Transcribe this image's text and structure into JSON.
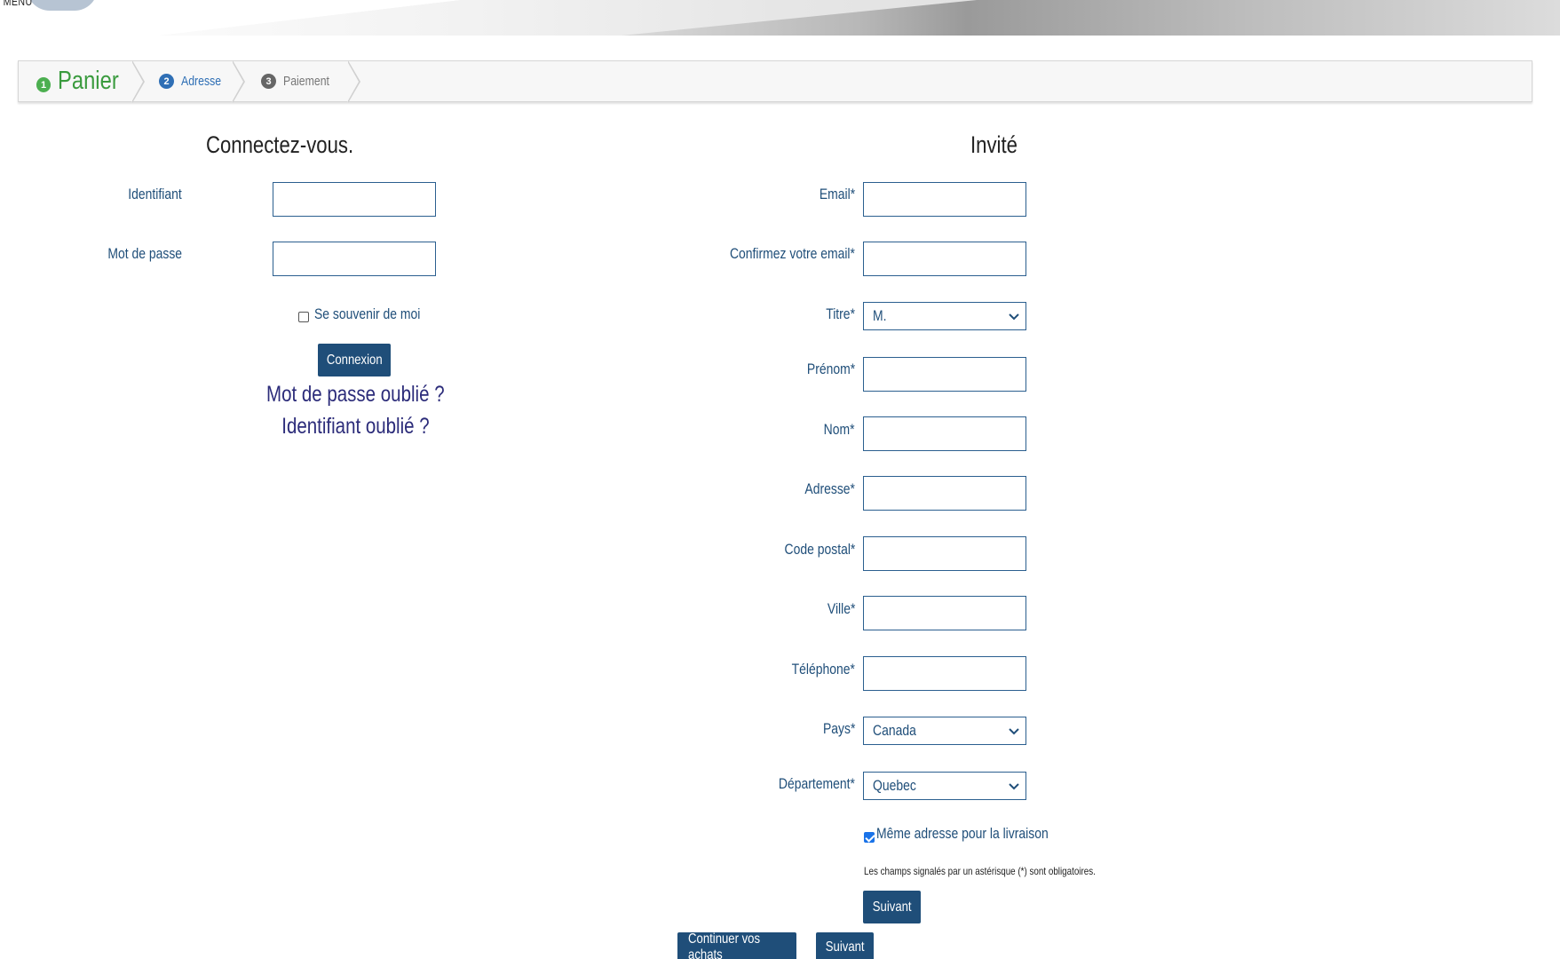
{
  "header": {
    "menu_label": "MENU"
  },
  "breadcrumb": {
    "steps": [
      {
        "number": "1",
        "label": "Panier"
      },
      {
        "number": "2",
        "label": "Adresse"
      },
      {
        "number": "3",
        "label": "Paiement"
      }
    ]
  },
  "login": {
    "title": "Connectez-vous.",
    "identifiant_label": "Identifiant",
    "identifiant_value": "",
    "password_label": "Mot de passe",
    "password_value": "",
    "remember_label": "Se souvenir de moi",
    "remember_checked": false,
    "connect_button": "Connexion",
    "forgot_password": "Mot de passe oublié ?",
    "forgot_identifiant": "Identifiant oublié ?"
  },
  "guest": {
    "title": "Invité",
    "email_label": "Email*",
    "confirm_email_label": "Confirmez votre email*",
    "titre_label": "Titre*",
    "titre_value": "M.",
    "prenom_label": "Prénom*",
    "nom_label": "Nom*",
    "adresse_label": "Adresse*",
    "code_postal_label": "Code postal*",
    "ville_label": "Ville*",
    "telephone_label": "Téléphone*",
    "pays_label": "Pays*",
    "pays_value": "Canada",
    "departement_label": "Département*",
    "departement_value": "Quebec",
    "same_address_label": "Même adresse pour la livraison",
    "same_address_checked": true,
    "required_note": "Les champs signalés par un astérisque (*) sont obligatoires.",
    "next_button": "Suivant"
  },
  "footer": {
    "continue_button": "Continuer vos achats",
    "next_button": "Suivant"
  }
}
